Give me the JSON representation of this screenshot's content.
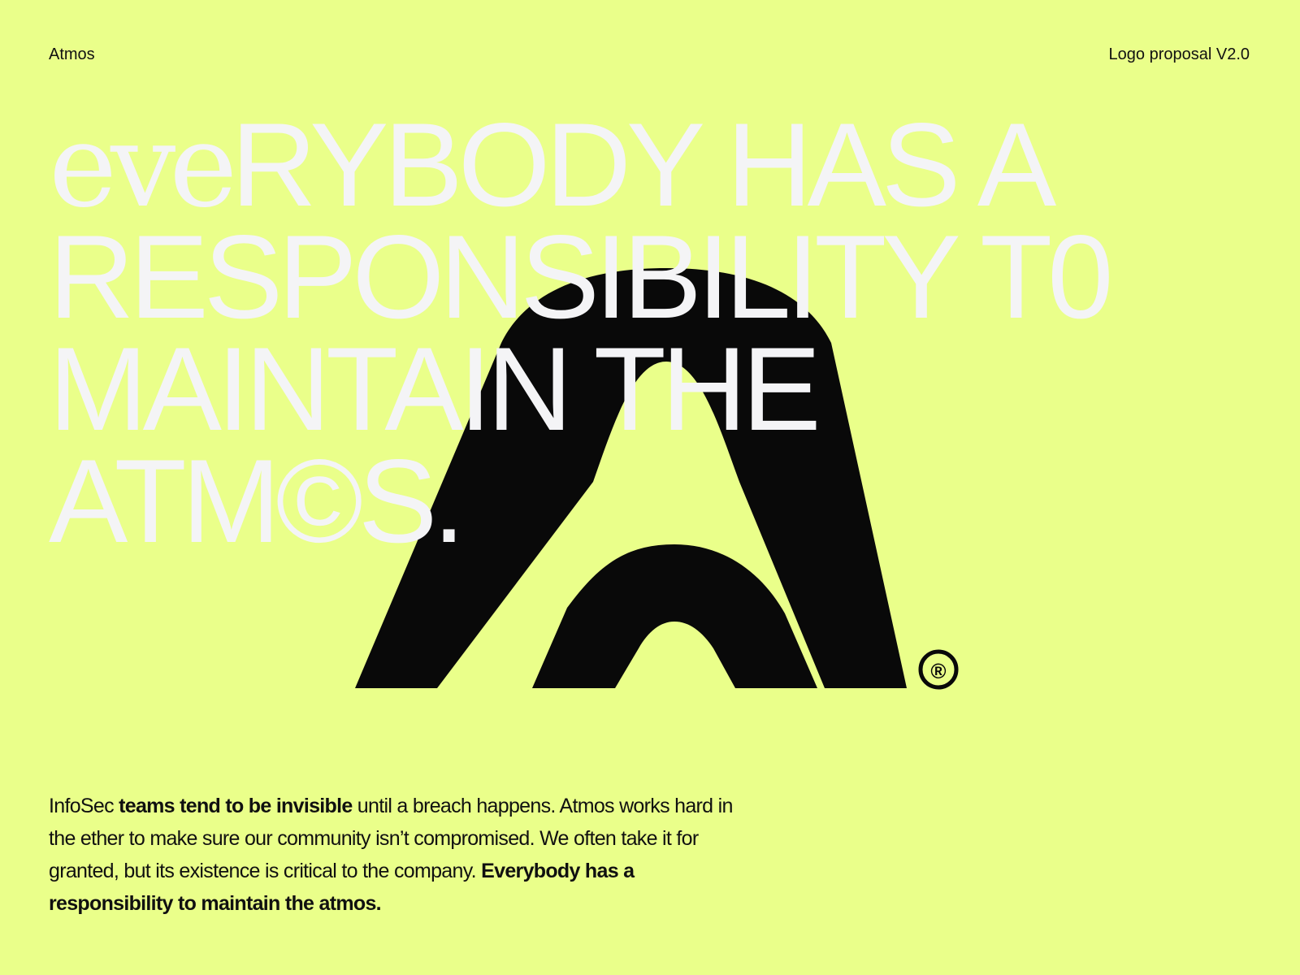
{
  "header": {
    "brand": "Atmos",
    "version": "Logo proposal V2.0"
  },
  "headline": {
    "line1_serif": "eve",
    "line1_rest": "RYBODY HAS A",
    "line2": "RESPONSIBILITY T0",
    "line3": "MAINTAIN THE",
    "line4": "ATM©S."
  },
  "logo": {
    "icon": "atmos-logo-icon",
    "registered_icon": "registered-trademark-icon",
    "registered_symbol": "®",
    "mark_color": "#090909",
    "background_color": "#eaff8a",
    "headline_color": "#f4f4f6"
  },
  "body": {
    "part1": "InfoSec ",
    "part2": "teams tend to be invisible",
    "part3": " until a breach happens. Atmos works hard in the ether to make sure our community isn’t compromised. We often take it for granted, but its existence is critical to the company. ",
    "part4": "Everybody has a responsibility to maintain the atmos."
  }
}
